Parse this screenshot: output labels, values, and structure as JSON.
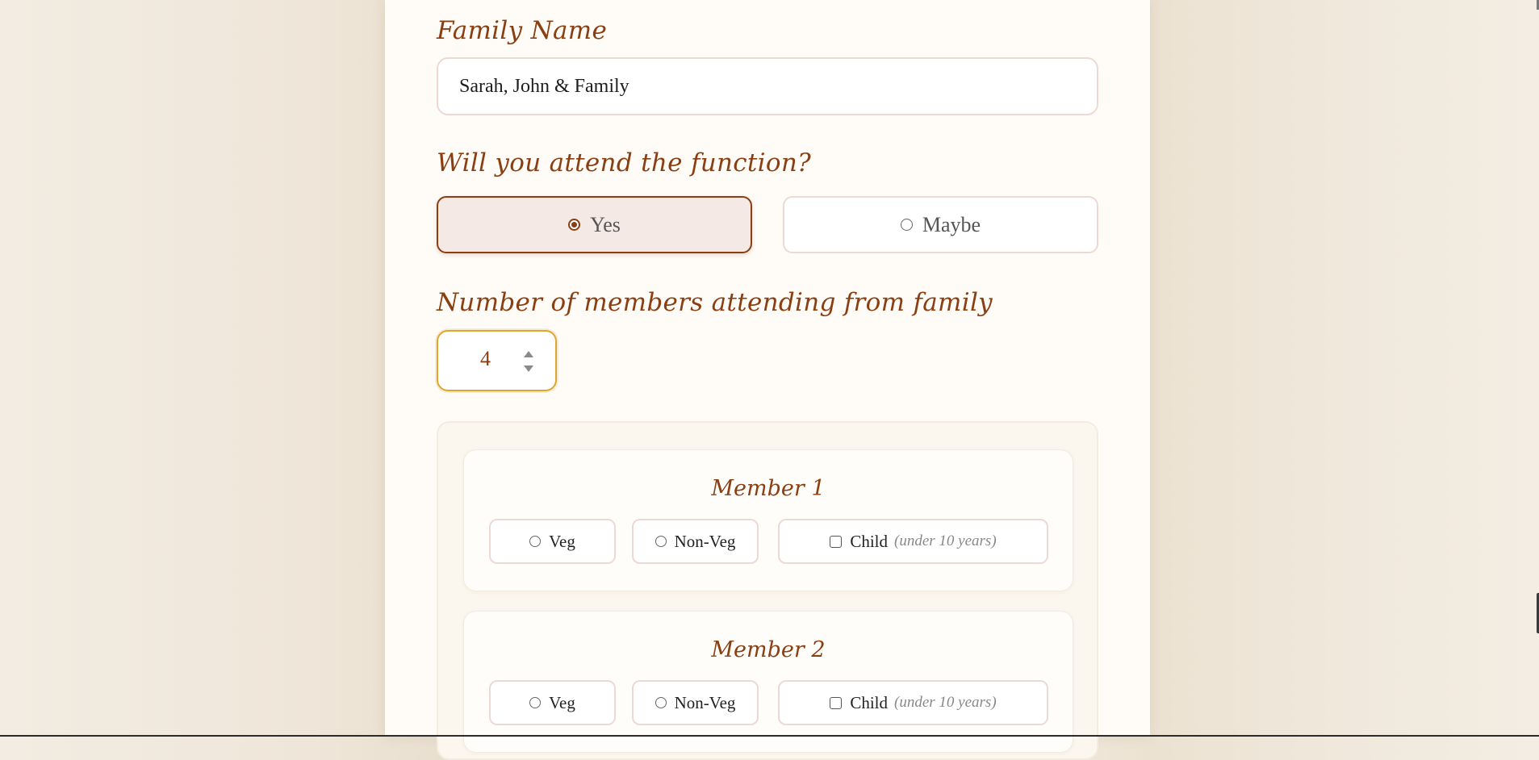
{
  "form": {
    "family_name": {
      "label": "Family Name",
      "value": "Sarah, John & Family"
    },
    "attendance": {
      "label": "Will you attend the function?",
      "options": [
        {
          "label": "Yes",
          "selected": true
        },
        {
          "label": "Maybe",
          "selected": false
        }
      ]
    },
    "member_count": {
      "label": "Number of members attending from family",
      "value": "4"
    },
    "members": [
      {
        "title": "Member 1",
        "veg_label": "Veg",
        "nonveg_label": "Non-Veg",
        "child_label": "Child",
        "child_hint": "(under 10 years)"
      },
      {
        "title": "Member 2",
        "veg_label": "Veg",
        "nonveg_label": "Non-Veg",
        "child_label": "Child",
        "child_hint": "(under 10 years)"
      }
    ]
  },
  "colors": {
    "accent": "#8a3f12",
    "focus_border": "#dfa62f",
    "field_border": "#ecd9d3",
    "background": "#f5efe6"
  },
  "icons": {
    "radio_checked": "radio-checked-icon",
    "radio_unchecked": "radio-unchecked-icon",
    "checkbox": "checkbox-icon",
    "spinner_up": "chevron-up-icon",
    "spinner_down": "chevron-down-icon"
  }
}
